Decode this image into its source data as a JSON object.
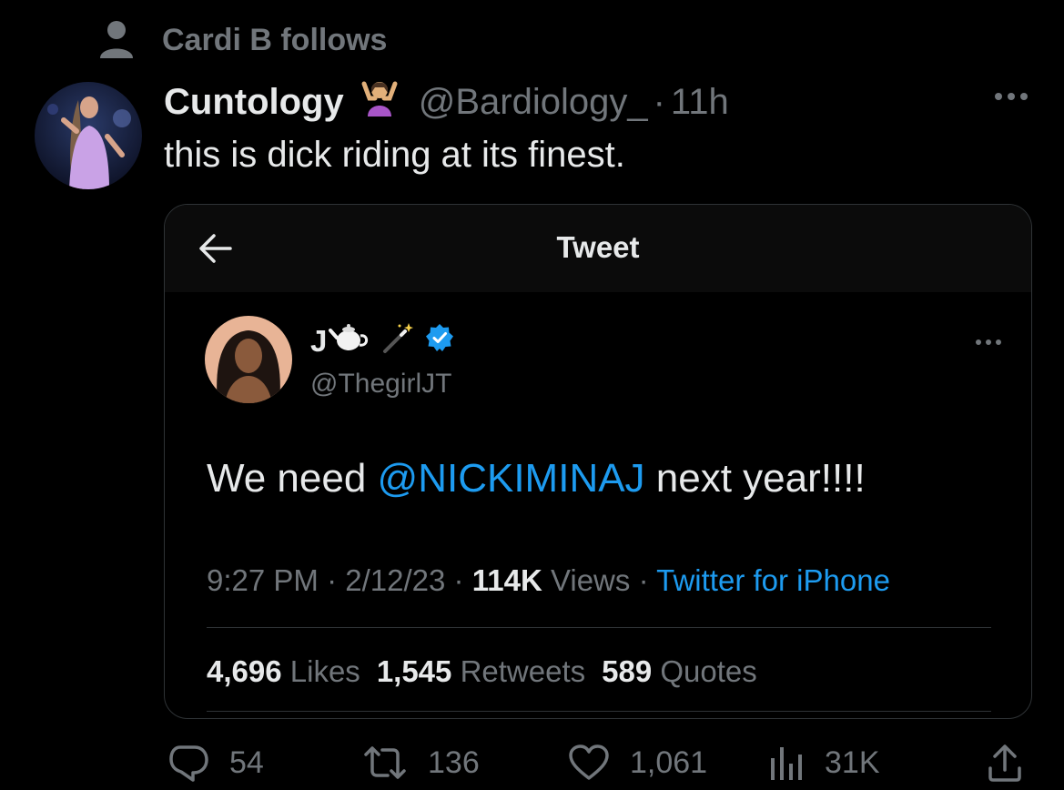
{
  "social_context": {
    "text": "Cardi B follows",
    "icon": "person-icon"
  },
  "tweet": {
    "display_name": "Cuntology",
    "name_emoji": "person-shrugging-emoji",
    "handle": "@Bardiology_",
    "separator": "·",
    "time": "11h",
    "text": "this is dick riding at its finest."
  },
  "quote": {
    "header_title": "Tweet",
    "author_name": "J",
    "author_emojis": [
      "teapot-emoji",
      "magic-wand-emoji"
    ],
    "verified": true,
    "author_handle": "@ThegirlJT",
    "text_before": "We need ",
    "mention": "@NICKIMINAJ",
    "text_after": " next year!!!!",
    "time": "9:27 PM",
    "date": "2/12/23",
    "views_count": "114K",
    "views_label": "Views",
    "source": "Twitter for iPhone",
    "sep": "·",
    "likes_count": "4,696",
    "likes_label": "Likes",
    "retweets_count": "1,545",
    "retweets_label": "Retweets",
    "quotes_count": "589",
    "quotes_label": "Quotes"
  },
  "actions": {
    "replies": "54",
    "retweets": "136",
    "likes": "1,061",
    "views": "31K"
  },
  "colors": {
    "background": "#000000",
    "text": "#e7e9ea",
    "muted": "#71767b",
    "accent": "#1d9bf0",
    "border": "#2f3336"
  }
}
